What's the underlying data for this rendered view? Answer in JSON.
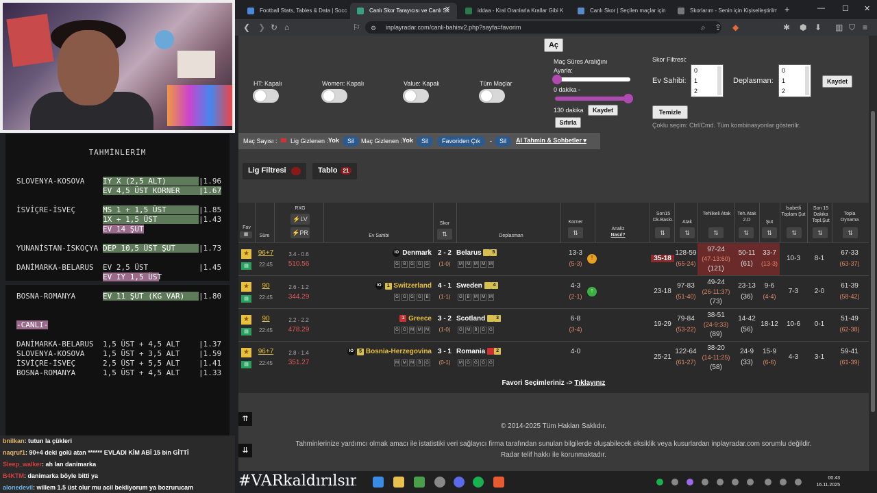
{
  "tabs": [
    {
      "label": "Football Stats, Tables & Data | Socc"
    },
    {
      "label": "Canlı Skor Tarayıcısı ve Canlı Sk"
    },
    {
      "label": "iddaa - Kral Oranlarla Krallar Gibi K"
    },
    {
      "label": "Canlı Skor | Seçilen maçlar için canl"
    },
    {
      "label": "Skorlarım - Senin için Kişiselleştirilm"
    }
  ],
  "url": "inplayradar.com/canli-bahisv2.php?sayfa=favorim",
  "predictions": {
    "title": "TAHMİNLERİM",
    "rows": [
      {
        "match": "SLOVENYA-KOSOVA",
        "pick": "IY X (2,5 ALT)",
        "odd": "|1.96"
      },
      {
        "match": "",
        "pick": "EV 4,5 ÜST KORNER",
        "odd": "|1.67"
      },
      {
        "match": "İSVİÇRE-İSVEÇ",
        "pick": "MS 1 + 1,5 ÜST",
        "odd": "|1.85"
      },
      {
        "match": "",
        "pick": "1X + 1,5 ÜST",
        "odd": "|1.43"
      },
      {
        "match": "",
        "pick": "EV 14 ŞUT",
        "odd": ""
      },
      {
        "match": "YUNANİSTAN-İSKOÇYA",
        "pick": "DEP 10,5 ÜST ŞUT",
        "odd": "|1.73"
      },
      {
        "match": "DANİMARKA-BELARUS",
        "pick": "EV 2,5 ÜST",
        "odd": "|1.45"
      },
      {
        "match": "",
        "pick": "EV IY 1,5 ÜST",
        "odd": ""
      },
      {
        "match": "BOSNA-ROMANYA",
        "pick": "EV 11 ŞUT (KG VAR)",
        "odd": "|1.80"
      }
    ],
    "live_title": "-CANLI-",
    "live_rows": [
      {
        "match": "DANİMARKA-BELARUS",
        "pick": "1,5 ÜST + 4,5 ALT",
        "odd": "|1.37"
      },
      {
        "match": "SLOVENYA-KOSOVA",
        "pick": "1,5 ÜST + 3,5 ALT",
        "odd": "|1.59"
      },
      {
        "match": "İSVİÇRE-İSVEÇ",
        "pick": "2,5 ÜST + 5,5 ALT",
        "odd": "|1.41"
      },
      {
        "match": "BOSNA-ROMANYA",
        "pick": "1,5 ÜST + 4,5 ALT",
        "odd": "|1.33"
      }
    ]
  },
  "chat": [
    {
      "user": "bnilkan",
      "text": ": tutun la çükleri"
    },
    {
      "user": "naqruf1",
      "text": ": 90+4 deki golü atan ****** EVLADI KİM ABİ 15 bin GİTTİ"
    },
    {
      "user": "Sleep_walker",
      "text": ": ah lan danimarka"
    },
    {
      "user": "B4KTM",
      "text": ": danimarka böyle bitti ya"
    },
    {
      "user": "alonedevil",
      "text": ": willem 1.5 üst olur mu acil bekliyorum ya bozrurucam"
    }
  ],
  "hashtag": "#VARkaldırılsın",
  "filters": {
    "ac": "Aç",
    "ht": "HT: Kapalı",
    "women": "Women: Kapalı",
    "value": "Value: Kapalı",
    "all": "Tüm Maçlar",
    "range_title": "Maç Süres Aralığını Ayarla:",
    "min_label": "0 dakika -",
    "max_label": "130 dakika",
    "save": "Kaydet",
    "reset": "Sıfırla",
    "score_title": "Skor Filtresi:",
    "home": "Ev Sahibi:",
    "away": "Deplasman:",
    "options": [
      "0",
      "1",
      "2"
    ],
    "clear": "Temizle",
    "hint": "Çoklu seçim: Ctrl/Cmd. Tüm kombinasyonlar gösterilir."
  },
  "bar": {
    "count_label": "Maç Sayısı :",
    "league_hidden": "Lig Gizlenen :",
    "yok1": "Yok",
    "sil1": "Sil",
    "match_hidden": "Maç Gizlenen :",
    "yok2": "Yok",
    "sil2": "Sil",
    "fav_out": "Favoriden Çık",
    "dash": "-",
    "sil3": "Sil",
    "ai": "AI Tahmin & Sohbetler"
  },
  "league_filter": "Lig Filtresi",
  "table_btn": "Tablo",
  "table_count": "21",
  "headers": {
    "fav": "Fav",
    "sure": "Süre",
    "rxg": "RXG",
    "lv": "LV",
    "pr": "PR",
    "home": "Ev Sahibi",
    "skor": "Skor",
    "away": "Deplasman",
    "korner": "Korner",
    "analiz": "Analiz",
    "nasil": "Nasıl?",
    "son15": "Son15 Dk.Baskı.",
    "atak": "Atak",
    "tehlikeli": "Tehlikeli Atak",
    "tehatak": "Teh.Atak 2.D",
    "sut": "Şut",
    "isabetli": "İsabetli Toplam Şut",
    "son15dk": "Son 15 Dakika Topl.Şut",
    "topla": "Topla Oynama"
  },
  "matches": [
    {
      "min": "96+7",
      "time": "22:45",
      "rxg": "3.4 - 0.6",
      "rxg2": "510.56",
      "home": "Denmark",
      "home_rank": "",
      "away": "Belarus",
      "away_rank": "5",
      "score": "2 - 2",
      "ht": "(1-0)",
      "corner": "13-3",
      "corner_ht": "(5-3)",
      "son15": "35-18",
      "atak": "128-59",
      "atak2": "(65-24)",
      "teh": "97-24",
      "teh2": "(47-13:60)",
      "teh3": "(121)",
      "teh2d": "50-11",
      "teh2d2": "(61)",
      "sut": "33-7",
      "sut2": "(13-3)",
      "isabet": "10-3",
      "son15sut": "8-1",
      "topla": "67-33",
      "topla2": "(63-37)",
      "hform": [
        "G",
        "B",
        "G",
        "G",
        "G"
      ],
      "aform": [
        "M",
        "M",
        "M",
        "M",
        "M"
      ]
    },
    {
      "min": "90",
      "time": "22:45",
      "rxg": "2.6 - 1.2",
      "rxg2": "344.29",
      "home": "Switzerland",
      "home_rank": "1",
      "away": "Sweden",
      "away_rank": "4",
      "score": "4 - 1",
      "ht": "(1-1)",
      "corner": "4-3",
      "corner_ht": "(2-1)",
      "son15": "23-18",
      "atak": "97-83",
      "atak2": "(51-40)",
      "teh": "49-24",
      "teh2": "(26-11:37)",
      "teh3": "(73)",
      "teh2d": "23-13",
      "teh2d2": "(36)",
      "sut": "9-6",
      "sut2": "(4-4)",
      "isabet": "7-3",
      "son15sut": "2-0",
      "topla": "61-39",
      "topla2": "(58-42)",
      "hform": [
        "G",
        "G",
        "G",
        "G",
        "B"
      ],
      "aform": [
        "G",
        "B",
        "M",
        "M",
        "M"
      ]
    },
    {
      "min": "90",
      "time": "22:45",
      "rxg": "2.2 - 2.2",
      "rxg2": "478.29",
      "home": "Greece",
      "home_rank": "1",
      "away": "Scotland",
      "away_rank": "3",
      "score": "3 - 2",
      "ht": "(1-0)",
      "corner": "6-8",
      "corner_ht": "(3-4)",
      "son15": "19-29",
      "atak": "79-84",
      "atak2": "(53-22)",
      "teh": "38-51",
      "teh2": "(24-9:33)",
      "teh3": "(89)",
      "teh2d": "14-42",
      "teh2d2": "(56)",
      "sut": "18-12",
      "sut2": "",
      "isabet": "10-6",
      "son15sut": "0-1",
      "topla": "51-49",
      "topla2": "(62-38)",
      "hform": [
        "G",
        "G",
        "M",
        "M",
        "M"
      ],
      "aform": [
        "G",
        "M",
        "B",
        "G",
        "G"
      ]
    },
    {
      "min": "96+7",
      "time": "22:45",
      "rxg": "2.8 - 1.4",
      "rxg2": "351.27",
      "home": "Bosnia-Herzegovina",
      "home_rank": "5",
      "away": "Romania",
      "away_rank": "2",
      "score": "3 - 1",
      "ht": "(0-1)",
      "corner": "4-0",
      "corner_ht": "",
      "son15": "25-21",
      "atak": "122-64",
      "atak2": "(61-27)",
      "teh": "38-20",
      "teh2": "(14-11:25)",
      "teh3": "(58)",
      "teh2d": "24-9",
      "teh2d2": "(33)",
      "sut": "15-9",
      "sut2": "(6-6)",
      "isabet": "4-3",
      "son15sut": "3-1",
      "topla": "59-41",
      "topla2": "(61-39)",
      "hform": [
        "M",
        "M",
        "M",
        "B",
        "G"
      ],
      "aform": [
        "M",
        "G",
        "G",
        "G",
        "G"
      ]
    }
  ],
  "fav_note": "Favori Seçimleriniz -> ",
  "fav_link": "Tıklayınız",
  "copyright": "© 2014-2025 Tüm Hakları Saklıdır.",
  "disclaimer1": "Tahminlerinize yardımcı olmak amacı ile istatistiki veri sağlayıcı firma tarafından sunulan bilgilerde oluşabilecek eksiklik veya kusurlardan inplayradar.com sorumlu değildir.",
  "disclaimer2": "Radar telif hakkı ile korunmaktadır.",
  "clock": {
    "time": "00:43",
    "date": "16.11.2025"
  }
}
